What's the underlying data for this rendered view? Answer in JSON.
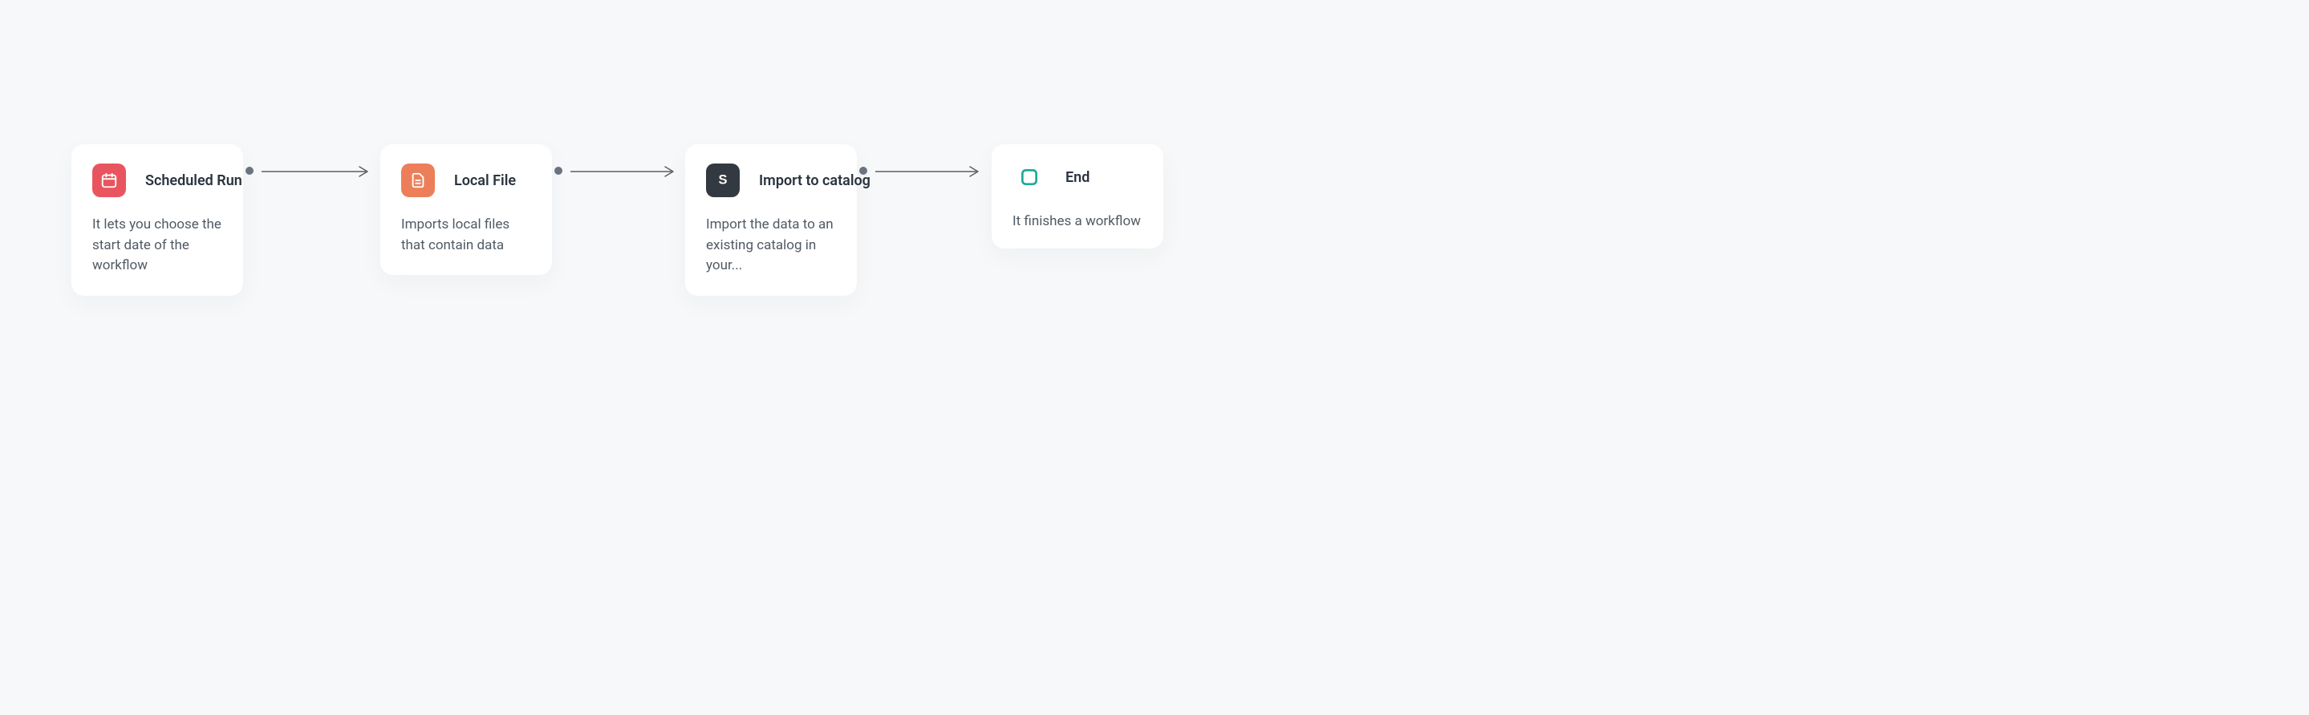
{
  "workflow": {
    "nodes": [
      {
        "id": "scheduled-run",
        "title": "Scheduled Run",
        "description": "It lets you choose the start date of the workflow",
        "icon": "calendar-icon",
        "color": "#e9555e"
      },
      {
        "id": "local-file",
        "title": "Local File",
        "description": "Imports local files that contain data",
        "icon": "file-icon",
        "color": "#ec7f59"
      },
      {
        "id": "import-catalog",
        "title": "Import to catalog",
        "description": "Import the data to an existing catalog in your...",
        "icon": "s-icon",
        "color": "#333940"
      },
      {
        "id": "end",
        "title": "End",
        "description": "It finishes a workflow",
        "icon": "stop-icon",
        "color": "#1fa99a"
      }
    ]
  }
}
